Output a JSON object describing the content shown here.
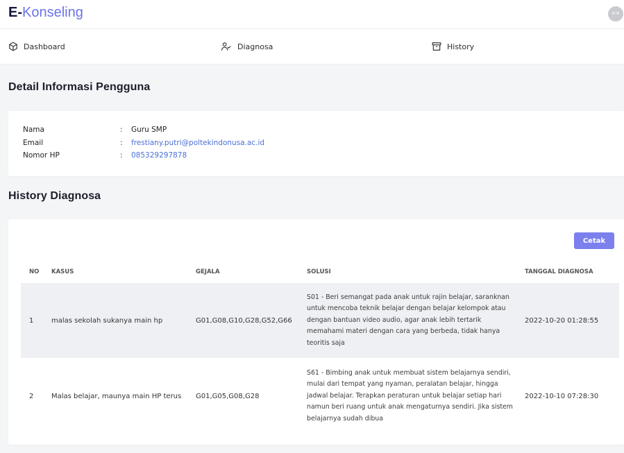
{
  "brand": {
    "part1": "E-",
    "part2": "Konseling"
  },
  "avatar": {
    "initials": "M M"
  },
  "nav": [
    {
      "label": "Dashboard",
      "icon": "cube-icon"
    },
    {
      "label": "Diagnosa",
      "icon": "user-check-icon"
    },
    {
      "label": "History",
      "icon": "archive-icon"
    }
  ],
  "detail": {
    "title": "Detail Informasi Pengguna",
    "separator": ":",
    "fields": [
      {
        "label": "Nama",
        "value": "Guru SMP"
      },
      {
        "label": "Email",
        "value": "frestiany.putri@poltekindonusa.ac.id"
      },
      {
        "label": "Nomor HP",
        "value": "085329297878"
      }
    ]
  },
  "history": {
    "title": "History Diagnosa",
    "print_label": "Cetak",
    "columns": [
      "NO",
      "KASUS",
      "GEJALA",
      "SOLUSI",
      "TANGGAL DIAGNOSA"
    ],
    "rows": [
      {
        "no": "1",
        "kasus": "malas sekolah sukanya main hp",
        "gejala": "G01,G08,G10,G28,G52,G66",
        "solusi": "S01 - Beri semangat pada anak untuk rajin belajar, saranknan untuk mencoba teknik belajar dengan belajar kelompok atau dengan bantuan video audio, agar anak lebih tertarik memahami materi dengan cara yang berbeda, tidak hanya teoritis saja",
        "tanggal": "2022-10-20 01:28:55"
      },
      {
        "no": "2",
        "kasus": "Malas belajar, maunya main HP terus",
        "gejala": "G01,G05,G08,G28",
        "solusi": "S61 - Bimbing anak untuk membuat sistem belajarnya sendiri, mulai dari tempat yang nyaman, peralatan belajar, hingga jadwal belajar. Terapkan peraturan untuk belajar setiap hari namun beri ruang untuk anak mengaturnya sendiri. Jika sistem belajarnya sudah dibua",
        "tanggal": "2022-10-10 07:28:30"
      }
    ]
  }
}
